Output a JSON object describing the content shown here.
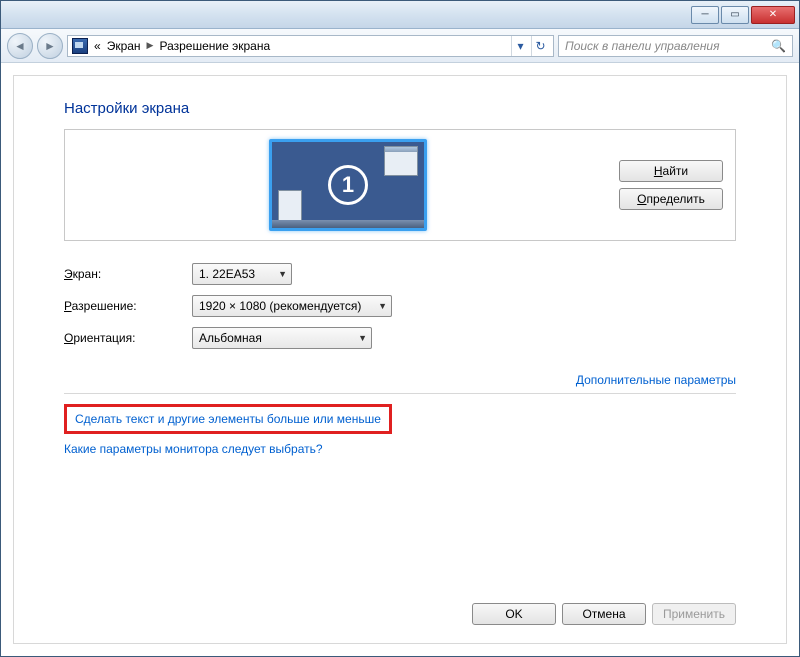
{
  "titlebar": {
    "minimize_glyph": "─",
    "maximize_glyph": "▭",
    "close_glyph": "✕"
  },
  "nav": {
    "back_glyph": "◄",
    "forward_glyph": "►",
    "double_left": "«",
    "crumb1": "Экран",
    "crumb_sep": "▶",
    "crumb2": "Разрешение экрана",
    "drop_glyph": "▾",
    "refresh_glyph": "↻",
    "search_placeholder": "Поиск в панели управления",
    "search_icon": "🔍"
  },
  "page": {
    "title": "Настройки экрана",
    "monitor_number": "1",
    "btn_find": "Найти",
    "btn_identify": "Определить"
  },
  "form": {
    "screen_label_pre": "",
    "screen_label": "Экран:",
    "screen_ul": "Э",
    "screen_value": "1. 22EA53",
    "resolution_label": "Разрешение:",
    "resolution_ul": "Р",
    "resolution_value": "1920 × 1080 (рекомендуется)",
    "orientation_label": "Ориентация:",
    "orientation_ul": "О",
    "orientation_value": "Альбомная"
  },
  "links": {
    "advanced": "Дополнительные параметры",
    "make_text": "Сделать текст и другие элементы больше или меньше",
    "which_settings": "Какие параметры монитора следует выбрать?"
  },
  "buttons": {
    "ok": "OK",
    "cancel": "Отмена",
    "apply": "Применить"
  }
}
